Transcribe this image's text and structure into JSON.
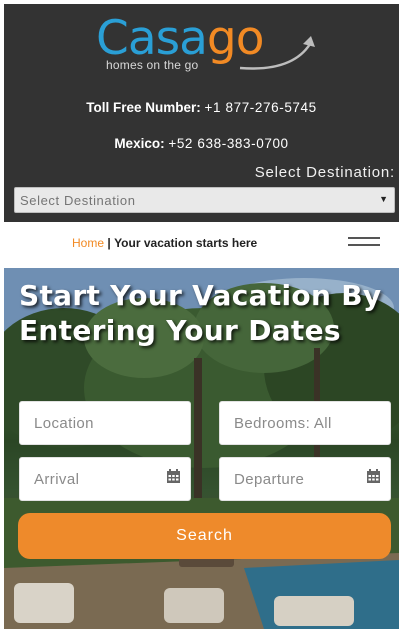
{
  "brand": {
    "logo_part1": "Casa",
    "logo_part2": "go",
    "tagline": "homes on the go",
    "color_blue": "#2a9fd6",
    "color_orange": "#f28a24"
  },
  "contact": {
    "toll_free_label": "Toll Free Number:",
    "toll_free_number": "+1 877-276-5745",
    "mexico_label": "Mexico:",
    "mexico_number": "+52 638-383-0700"
  },
  "destination": {
    "label": "Select Destination:",
    "selected": "Select Destination",
    "arrow_icon": "dropdown-arrow"
  },
  "breadcrumb": {
    "home": "Home",
    "separator": "|",
    "current": "Your vacation starts here"
  },
  "nav": {
    "menu_icon": "hamburger-menu-icon"
  },
  "hero": {
    "title": "Start Your Vacation By Entering Your Dates",
    "location_placeholder": "Location",
    "bedrooms_value": "Bedrooms: All",
    "arrival_placeholder": "Arrival",
    "departure_placeholder": "Departure",
    "calendar_icon": "calendar-icon",
    "search_label": "Search",
    "button_color": "#ee8a2b"
  }
}
